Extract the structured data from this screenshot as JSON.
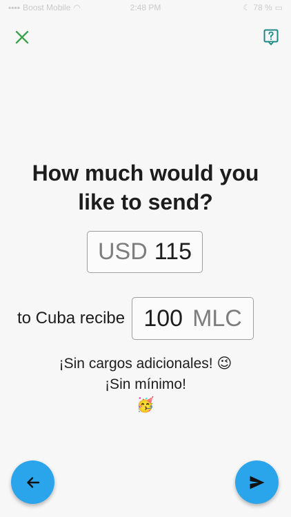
{
  "status_bar": {
    "carrier": "Boost Mobile",
    "time": "2:48 PM",
    "battery": "78 %"
  },
  "header": {
    "close_icon": "close-icon",
    "help_icon": "help-icon"
  },
  "main": {
    "title_line1": "How much would you",
    "title_line2": "like to send?",
    "send_currency": "USD",
    "send_amount": "115",
    "receive_label": "to Cuba recibe",
    "receive_amount": "100",
    "receive_currency": "MLC",
    "promo_line1": "¡Sin cargos adicionales!",
    "promo_emoji1": "😉",
    "promo_line2": "¡Sin mínimo!",
    "promo_emoji2": "🥳"
  },
  "footer": {
    "back_icon": "arrow-left-icon",
    "send_icon": "send-icon"
  },
  "colors": {
    "accent": "#2aa4ea",
    "close": "#3fa14f",
    "help": "#1a8a86"
  }
}
